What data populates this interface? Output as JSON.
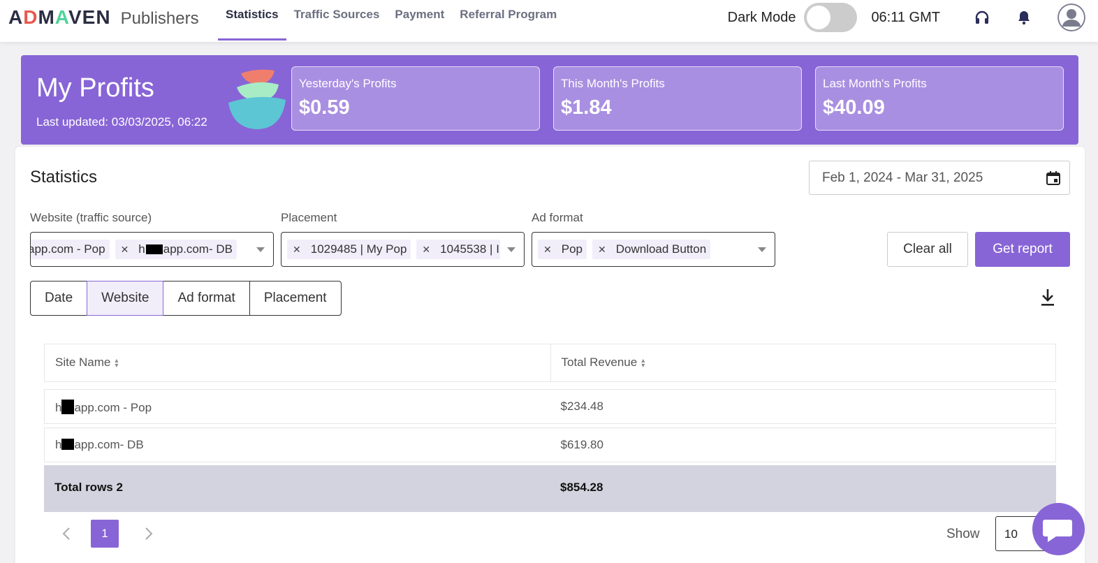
{
  "header": {
    "brand": "ADMAVEN",
    "brand_sub": "Publishers",
    "nav": [
      {
        "label": "Statistics",
        "active": true
      },
      {
        "label": "Traffic Sources",
        "active": false
      },
      {
        "label": "Payment",
        "active": false
      },
      {
        "label": "Referral Program",
        "active": false
      }
    ],
    "dark_mode_label": "Dark Mode",
    "dark_mode_on": false,
    "clock": "06:11 GMT",
    "icons": [
      "headset-icon",
      "bell-icon",
      "user-avatar-icon"
    ]
  },
  "banner": {
    "title": "My Profits",
    "last_updated": "Last updated: 03/03/2025, 06:22",
    "cards": [
      {
        "label": "Yesterday's Profits",
        "value": "$0.59"
      },
      {
        "label": "This Month's Profits",
        "value": "$1.84"
      },
      {
        "label": "Last Month's Profits",
        "value": "$40.09"
      }
    ]
  },
  "stats": {
    "title": "Statistics",
    "date_range": "Feb 1, 2024 - Mar 31, 2025",
    "filters": {
      "website": {
        "label": "Website (traffic source)",
        "chips": [
          {
            "prefix": "",
            "text": "app.com - Pop",
            "redacted": true
          },
          {
            "prefix": "h",
            "text": "app.com- DB",
            "redacted": true
          }
        ]
      },
      "placement": {
        "label": "Placement",
        "chips": [
          {
            "text": "1029485 | My Pop"
          },
          {
            "text": "1045538 | I"
          }
        ]
      },
      "ad_format": {
        "label": "Ad format",
        "chips": [
          {
            "text": "Pop"
          },
          {
            "text": "Download Button"
          }
        ]
      }
    },
    "buttons": {
      "clear": "Clear all",
      "report": "Get report"
    },
    "group_by": [
      {
        "label": "Date",
        "active": false
      },
      {
        "label": "Website",
        "active": true
      },
      {
        "label": "Ad format",
        "active": false
      },
      {
        "label": "Placement",
        "active": false
      }
    ],
    "table": {
      "columns": [
        "Site Name",
        "Total Revenue"
      ],
      "rows": [
        {
          "site_prefix": "h",
          "site_suffix": "app.com - Pop",
          "revenue": "$234.48"
        },
        {
          "site_prefix": "h",
          "site_suffix": "app.com- DB",
          "revenue": "$619.80"
        }
      ],
      "total_label": "Total rows 2",
      "total_value": "$854.28"
    },
    "pagination": {
      "current_page": "1",
      "show_label": "Show",
      "page_size": "10"
    }
  },
  "colors": {
    "accent": "#8865d6",
    "banner": "#8865d6",
    "total_row": "#d3d3df"
  }
}
